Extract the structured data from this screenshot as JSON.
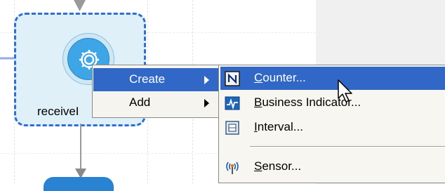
{
  "canvas": {
    "activity": {
      "label": "receiveI",
      "icon": "gear-icon"
    }
  },
  "context_menu": {
    "items": [
      {
        "label": "Create",
        "has_submenu": true,
        "highlighted": true
      },
      {
        "label": "Add",
        "has_submenu": true,
        "highlighted": false
      }
    ]
  },
  "submenu": {
    "items": [
      {
        "icon": "counter-icon",
        "mnemonic": "C",
        "rest": "ounter...",
        "highlighted": true
      },
      {
        "icon": "business-indicator-icon",
        "mnemonic": "B",
        "rest": "usiness Indicator...",
        "highlighted": false
      },
      {
        "icon": "interval-icon",
        "mnemonic": "I",
        "rest": "nterval...",
        "highlighted": false
      },
      {
        "icon": "sensor-icon",
        "mnemonic": "S",
        "rest": "ensor...",
        "highlighted": false
      }
    ]
  },
  "colors": {
    "selection": "#3168c8",
    "activity_border": "#2f6fd4",
    "activity_fill": "#dff0f8",
    "icon_blue": "#3ea6e6"
  }
}
